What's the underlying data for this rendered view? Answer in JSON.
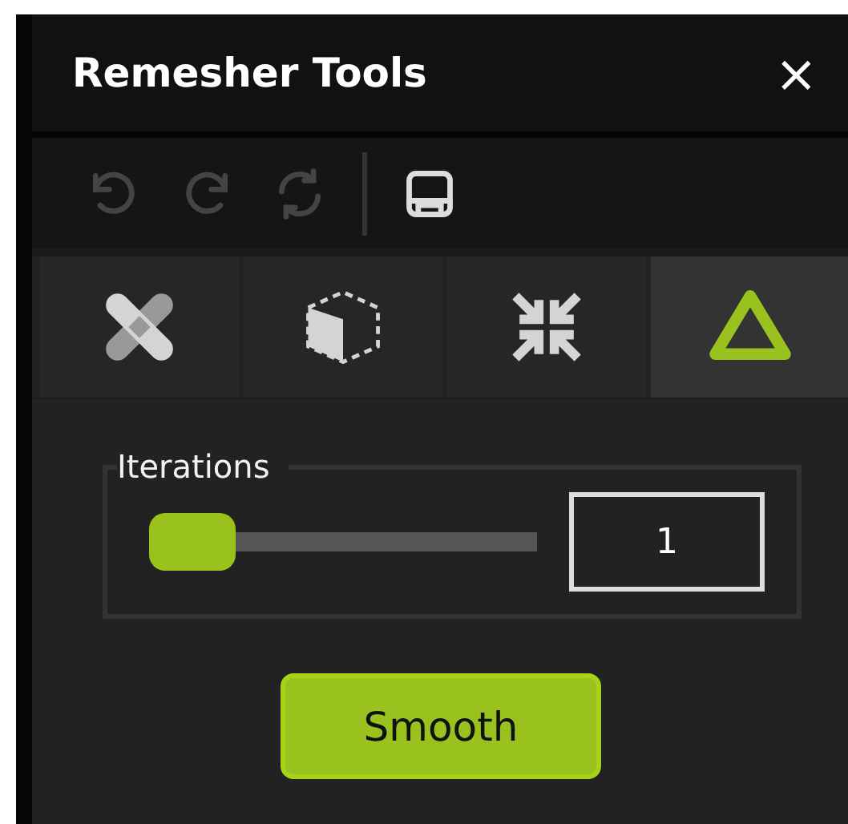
{
  "window": {
    "title": "Remesher Tools",
    "close": "×"
  },
  "toolbar": [
    {
      "kind": "undo",
      "disabled": true
    },
    {
      "kind": "redo",
      "disabled": true
    },
    {
      "kind": "refresh",
      "disabled": true
    },
    {
      "kind": "separator"
    },
    {
      "kind": "save",
      "disabled": false
    }
  ],
  "tabs": [
    {
      "kind": "bandage",
      "selected": false
    },
    {
      "kind": "cube",
      "selected": false
    },
    {
      "kind": "shrink",
      "selected": false
    },
    {
      "kind": "triangle",
      "selected": true
    }
  ],
  "iterations": {
    "label": "Iterations",
    "level": 0,
    "value": "1"
  },
  "action_button": "Smooth"
}
